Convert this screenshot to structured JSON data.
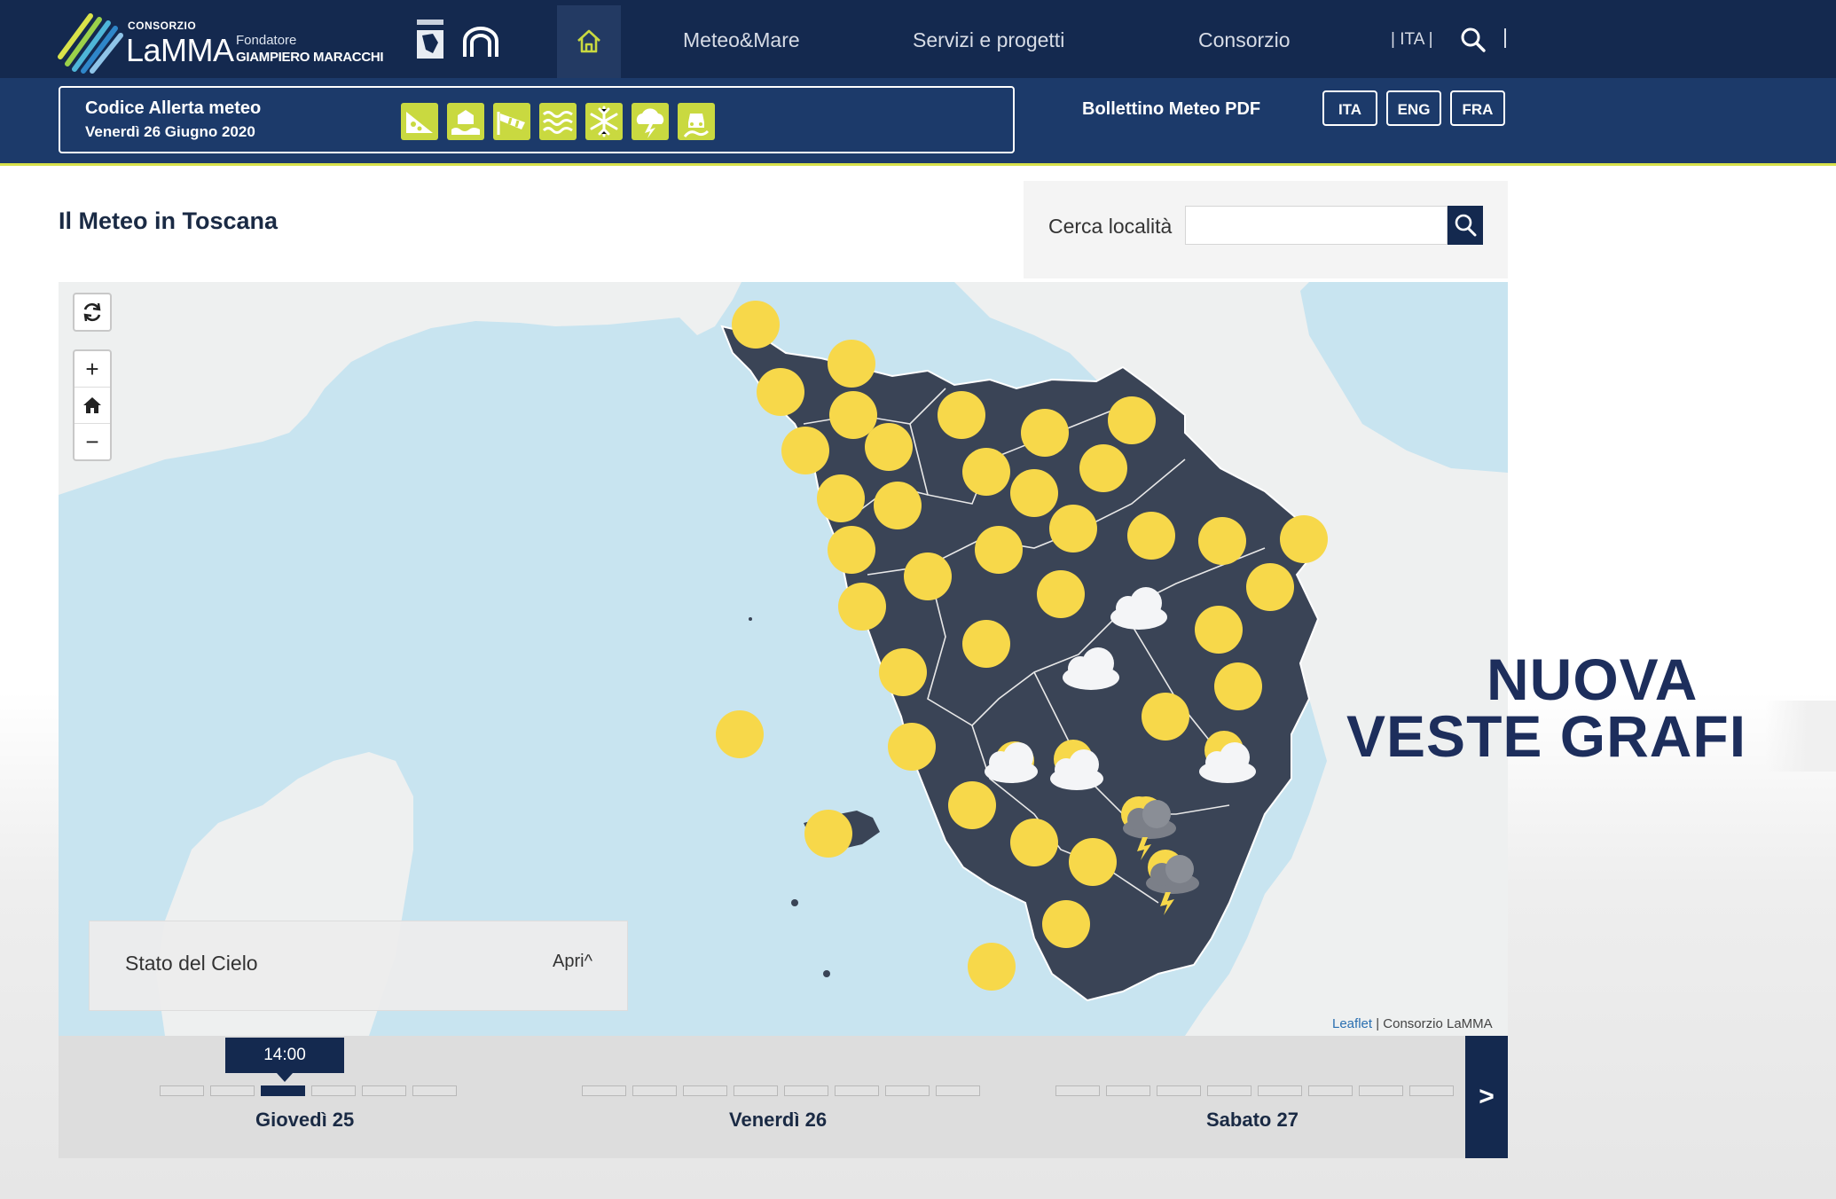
{
  "header": {
    "logo_small": "CONSORZIO",
    "logo_big": "LaMMA",
    "founder_label": "Fondatore",
    "founder_name": "GIAMPIERO MARACCHI",
    "nav": [
      "Meteo&Mare",
      "Servizi e progetti",
      "Consorzio"
    ],
    "lang_label": "| ITA |"
  },
  "alert": {
    "title": "Codice Allerta meteo",
    "date": "Venerdì 26 Giugno 2020",
    "icons": [
      "landslide-icon",
      "flood-icon",
      "wind-icon",
      "sea-waves-icon",
      "snow-icon",
      "thunderstorm-icon",
      "ice-road-icon"
    ],
    "color": "#c9d940"
  },
  "bulletin": {
    "label": "Bollettino Meteo PDF",
    "langs": [
      "ITA",
      "ENG",
      "FRA"
    ]
  },
  "main": {
    "title": "Il Meteo in Toscana",
    "search_label": "Cerca località",
    "search_value": "",
    "search_placeholder": ""
  },
  "map": {
    "legend_label": "Stato del Cielo",
    "legend_open": "Apri",
    "attribution_leaflet": "Leaflet",
    "attribution_sep": " | ",
    "attribution_owner": "Consorzio LaMMA",
    "symbol_colors": {
      "sun": "#f7d84a",
      "land": "#3a4456",
      "sea": "#c8e4f0",
      "other_land": "#eef0f0"
    }
  },
  "timeline": {
    "tooltip": "14:00",
    "days": [
      "Giovedì 25",
      "Venerdì 26",
      "Sabato 27"
    ],
    "next_label": ">"
  },
  "overlay": {
    "line1": "NUOVA",
    "line2": "VESTE GRAFI"
  },
  "colors": {
    "nav": "#14294f",
    "subnav": "#1c3a6a",
    "accent": "#d7e04a"
  }
}
